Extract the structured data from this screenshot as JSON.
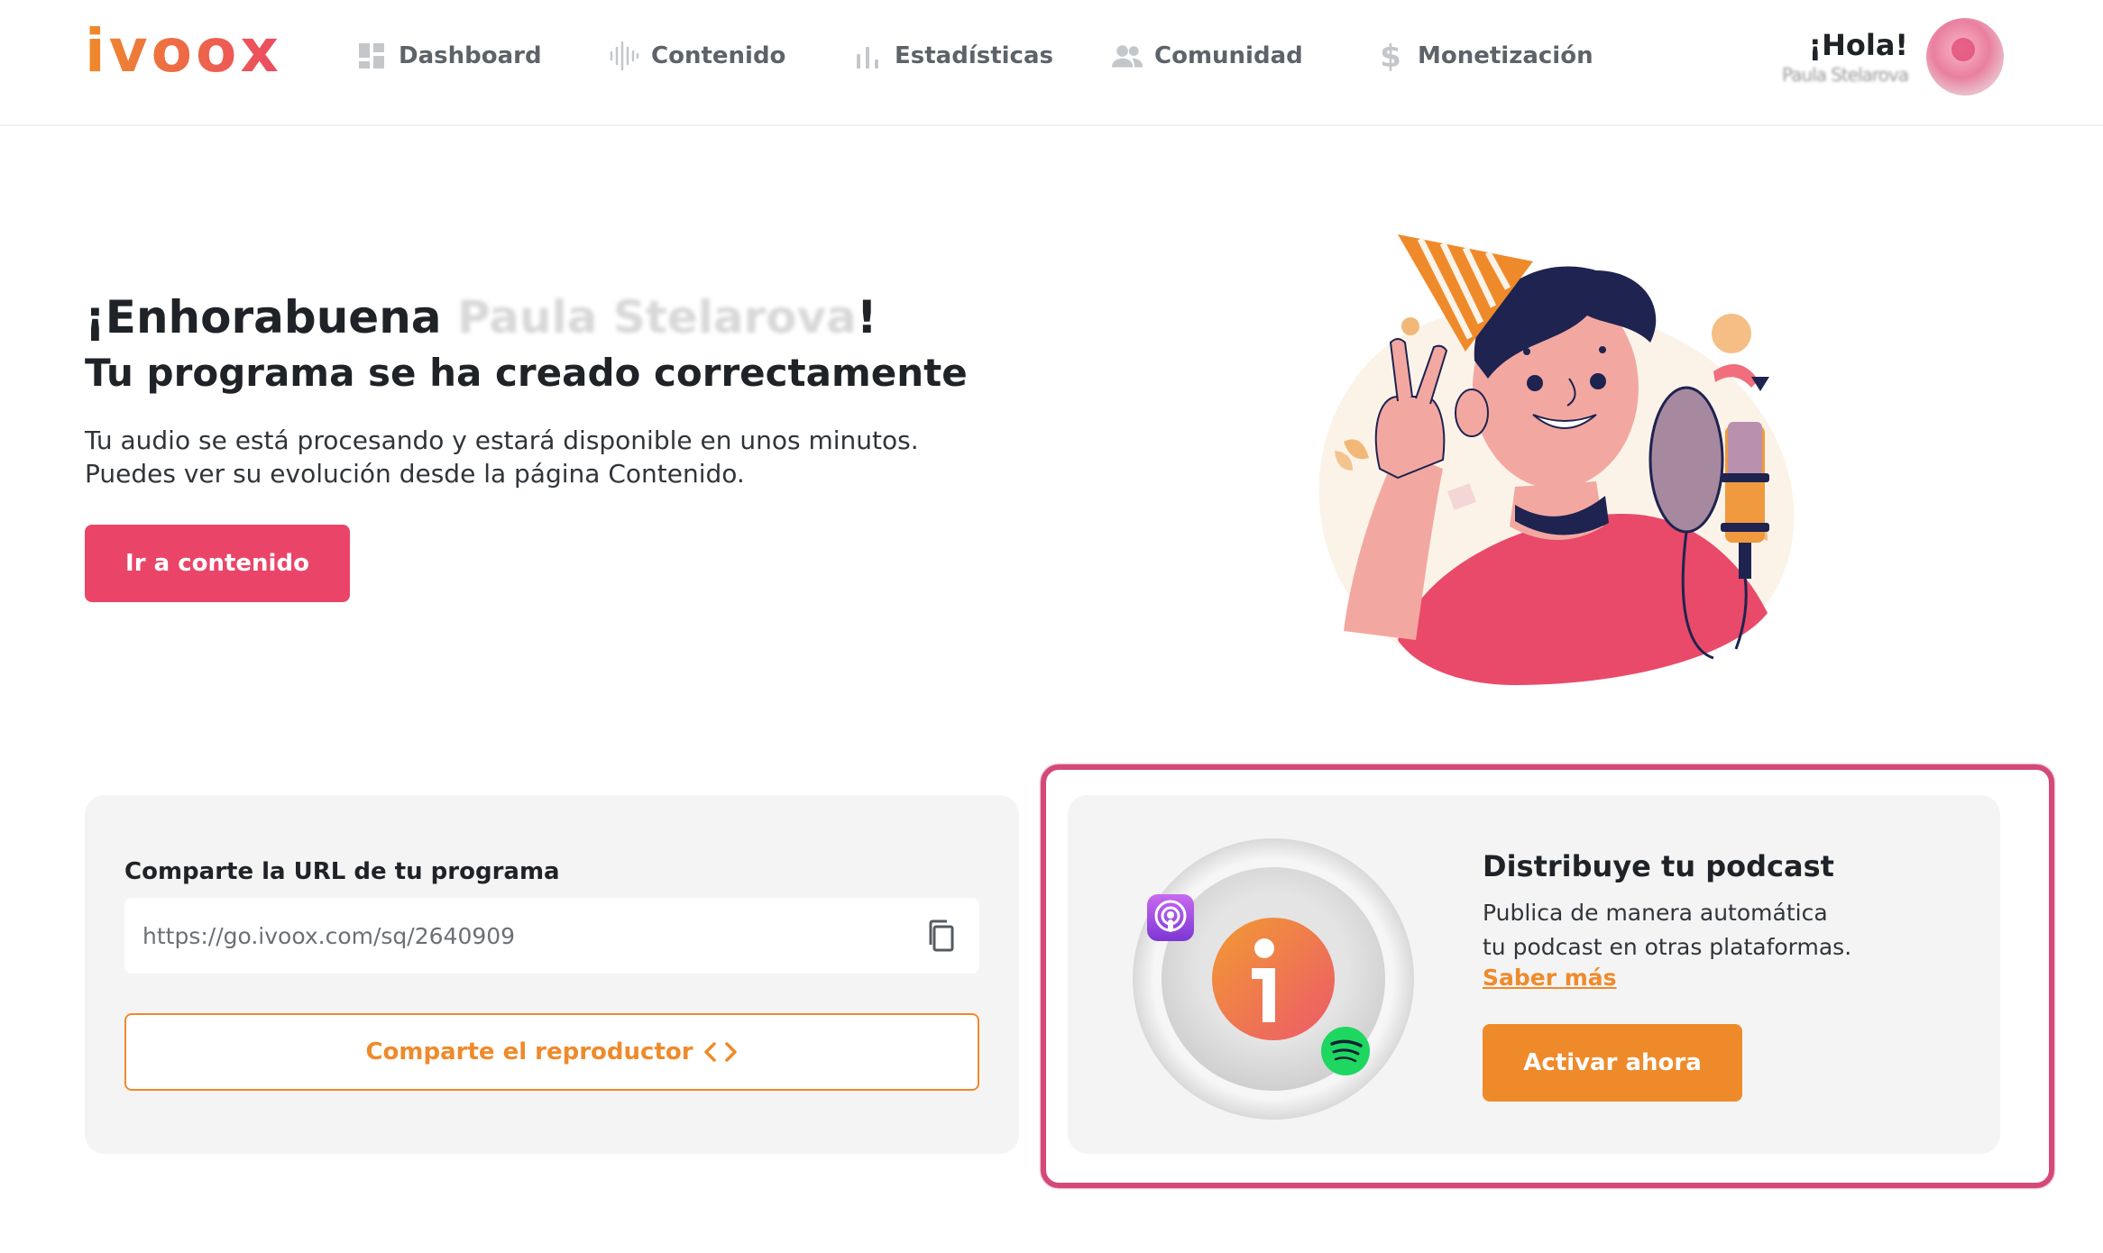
{
  "header": {
    "logo": "ivoox",
    "nav": [
      {
        "label": "Dashboard",
        "icon": "dashboard-icon"
      },
      {
        "label": "Contenido",
        "icon": "soundwave-icon"
      },
      {
        "label": "Estadísticas",
        "icon": "bar-chart-icon"
      },
      {
        "label": "Comunidad",
        "icon": "people-icon"
      },
      {
        "label": "Monetización",
        "icon": "dollar-icon"
      }
    ],
    "user": {
      "greeting": "¡Hola!",
      "name": "Paula Stelarova"
    }
  },
  "hero": {
    "title_prefix": "¡Enhorabuena ",
    "title_name": "Paula Stelarova",
    "title_suffix": "!",
    "subtitle": "Tu programa se ha creado correctamente",
    "description_line1": "Tu audio se está procesando y estará disponible en unos minutos.",
    "description_line2": "Puedes ver su evolución desde la página Contenido.",
    "button": "Ir a contenido"
  },
  "share": {
    "label": "Comparte la URL de tu programa",
    "url": "https://go.ivoox.com/sq/2640909",
    "button": "Comparte el reproductor"
  },
  "distribute": {
    "title": "Distribuye tu podcast",
    "description_line1": "Publica de manera automática",
    "description_line2": "tu podcast en otras plataformas.",
    "link": "Saber más",
    "button": "Activar ahora"
  },
  "colors": {
    "brand_orange": "#ef8a2b",
    "brand_pink": "#ea4568",
    "highlight": "#d4487a",
    "card_bg": "#f4f4f4"
  }
}
